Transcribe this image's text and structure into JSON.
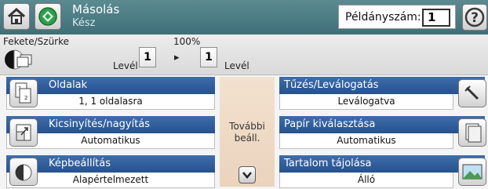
{
  "header": {
    "title": "Másolás",
    "subtitle": "Kész",
    "copies_label": "Példányszám:",
    "copies_value": "1",
    "help_label": "?"
  },
  "strip": {
    "mode": "Fekete/Szürke",
    "zoom": "100%",
    "paper_left": "Levél",
    "sides_left": "1",
    "arrow": "▸",
    "sides_right": "1",
    "paper_right": "Levél"
  },
  "options": {
    "sides": {
      "title": "Oldalak",
      "value": "1, 1 oldalasra"
    },
    "reduce": {
      "title": "Kicsinyítés/nagyítás",
      "value": "Automatikus"
    },
    "image": {
      "title": "Képbeállítás",
      "value": "Alapértelmezett"
    },
    "finishing": {
      "title": "Tűzés/Leválogatás",
      "value": "Leválogatva"
    },
    "paper": {
      "title": "Papír kiválasztása",
      "value": "Automatikus"
    },
    "orientation": {
      "title": "Tartalom tájolása",
      "value": "Álló"
    }
  },
  "more": {
    "line1": "További",
    "line2": "beáll."
  },
  "colors": {
    "header": "#4d7f87",
    "option_bar": "#2f5c99",
    "more_bg": "#efdcc8"
  }
}
